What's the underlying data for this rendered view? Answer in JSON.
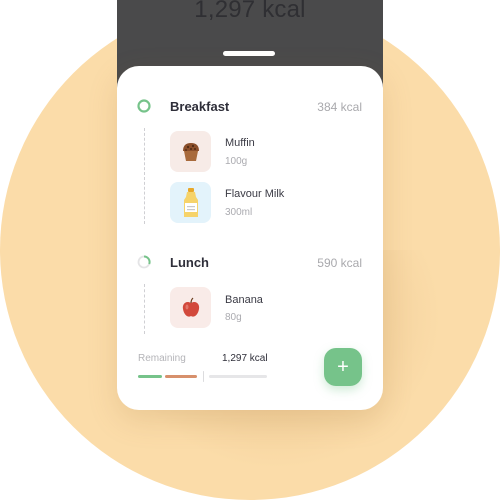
{
  "header": {
    "total_kcal": "1,297 kcal"
  },
  "meals": [
    {
      "name": "Breakfast",
      "kcal": "384 kcal",
      "progress": 1.0,
      "ring_color": "#76c38a",
      "items": [
        {
          "name": "Muffin",
          "qty": "100g",
          "icon": "muffin-icon",
          "thumb_color": "#f7ebe7"
        },
        {
          "name": "Flavour Milk",
          "qty": "300ml",
          "icon": "milk-bottle-icon",
          "thumb_color": "#e3f3fb"
        }
      ]
    },
    {
      "name": "Lunch",
      "kcal": "590 kcal",
      "progress": 0.3,
      "ring_color": "#76c38a",
      "items": [
        {
          "name": "Banana",
          "qty": "80g",
          "icon": "apple-icon",
          "thumb_color": "#f9ebe8"
        }
      ]
    }
  ],
  "footer": {
    "remaining_label": "Remaining",
    "remaining_value": "1,297 kcal",
    "add_symbol": "+",
    "bars": [
      {
        "color": "#76c38a",
        "progress": 1.0
      },
      {
        "color": "#d7906c",
        "progress": 1.0
      },
      {
        "color": "#e6e6e8",
        "progress": 0.0
      }
    ]
  },
  "colors": {
    "background": "#fbdca9",
    "phone": "#4a4a4b",
    "accent": "#76c38a"
  }
}
